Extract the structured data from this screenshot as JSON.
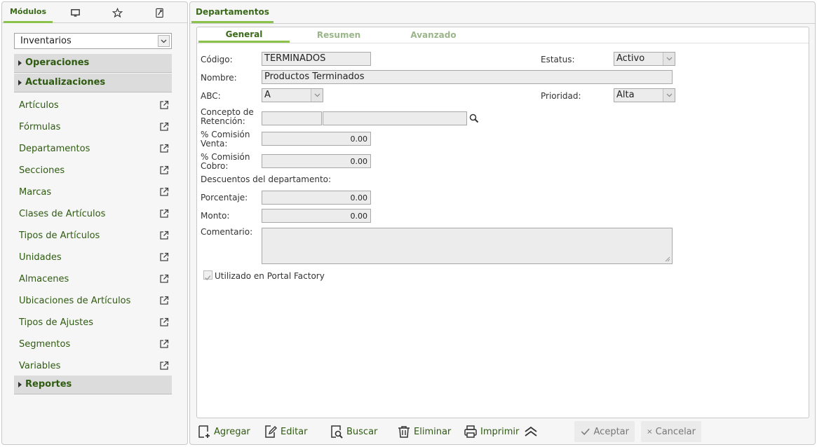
{
  "left": {
    "tabs": {
      "modulos": "Módulos",
      "desktop_icon": "desktop-icon",
      "favorites_icon": "star-icon",
      "tools_icon": "tools-icon"
    },
    "module_select": {
      "value": "Inventarios"
    },
    "sections": {
      "operaciones": "Operaciones",
      "actualizaciones": "Actualizaciones",
      "reportes": "Reportes"
    },
    "items": [
      "Artículos",
      "Fórmulas",
      "Departamentos",
      "Secciones",
      "Marcas",
      "Clases de Artículos",
      "Tipos de Artículos",
      "Unidades",
      "Almacenes",
      "Ubicaciones de Artículos",
      "Tipos de Ajustes",
      "Segmentos",
      "Variables"
    ]
  },
  "right": {
    "tab": "Departamentos",
    "form_tabs": {
      "general": "General",
      "resumen": "Resumen",
      "avanzado": "Avanzado"
    },
    "labels": {
      "codigo": "Código:",
      "nombre": "Nombre:",
      "abc": "ABC:",
      "concepto_1": "Concepto de",
      "concepto_2": "Retención:",
      "comision_venta_1": "% Comisión",
      "comision_venta_2": "Venta:",
      "comision_cobro_1": "% Comisión",
      "comision_cobro_2": "Cobro:",
      "descuentos": "Descuentos del departamento:",
      "porcentaje": "Porcentaje:",
      "monto": "Monto:",
      "comentario": "Comentario:",
      "estatus": "Estatus:",
      "prioridad": "Prioridad:",
      "portal": "Utilizado en Portal Factory"
    },
    "values": {
      "codigo": "TERMINADOS",
      "nombre": "Productos Terminados",
      "abc": "A",
      "estatus": "Activo",
      "prioridad": "Alta",
      "comision_venta": "0.00",
      "comision_cobro": "0.00",
      "porcentaje": "0.00",
      "monto": "0.00",
      "portal_checked": true
    },
    "toolbar": {
      "agregar": "Agregar",
      "editar": "Editar",
      "buscar": "Buscar",
      "eliminar": "Eliminar",
      "imprimir": "Imprimir",
      "aceptar": "Aceptar",
      "cancelar": "Cancelar"
    }
  },
  "colors": {
    "accent": "#8bc34a",
    "text_green": "#2e5b10",
    "disabled_green": "#9bb58a"
  }
}
